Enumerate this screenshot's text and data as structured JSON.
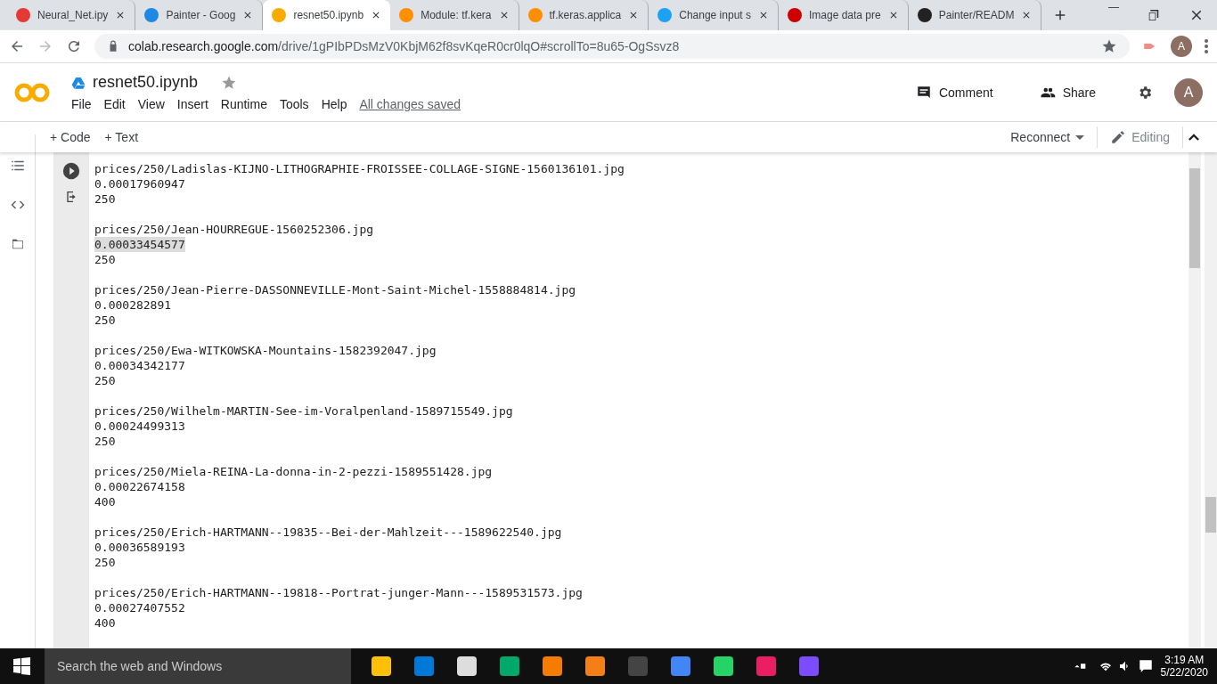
{
  "browser_tabs": [
    {
      "title": "Neural_Net.ipy",
      "selected": false
    },
    {
      "title": "Painter - Goog",
      "selected": false
    },
    {
      "title": "resnet50.ipynb",
      "selected": true
    },
    {
      "title": "Module: tf.kera",
      "selected": false
    },
    {
      "title": "tf.keras.applica",
      "selected": false
    },
    {
      "title": "Change input s",
      "selected": false
    },
    {
      "title": "Image data pre",
      "selected": false
    },
    {
      "title": "Painter/READM",
      "selected": false
    }
  ],
  "address_bar": {
    "host": "colab.research.google.com",
    "path": "/drive/1gPIbPDsMzV0KbjM62f8svKqeR0cr0lqO#scrollTo=8u65-OgSsvz8"
  },
  "profile_initial": "A",
  "notebook": {
    "title": "resnet50.ipynb",
    "menu": [
      "File",
      "Edit",
      "View",
      "Insert",
      "Runtime",
      "Tools",
      "Help"
    ],
    "save_status": "All changes saved"
  },
  "header_actions": {
    "comment": "Comment",
    "share": "Share",
    "avatar": "A"
  },
  "toolbar": {
    "add_code": "+ Code",
    "add_text": "+ Text",
    "connect": "Reconnect",
    "mode": "Editing"
  },
  "output": [
    {
      "path": "prices/250/Ladislas-KIJNO-LITHOGRAPHIE-FROISSEE-COLLAGE-SIGNE-1560136101.jpg",
      "score": "0.00017960947",
      "price": "250",
      "score_highlighted": false
    },
    {
      "path": "prices/250/Jean-HOURREGUE-1560252306.jpg",
      "score": "0.00033454577",
      "price": "250",
      "score_highlighted": true
    },
    {
      "path": "prices/250/Jean-Pierre-DASSONNEVILLE-Mont-Saint-Michel-1558884814.jpg",
      "score": "0.000282891",
      "price": "250",
      "score_highlighted": false
    },
    {
      "path": "prices/250/Ewa-WITKOWSKA-Mountains-1582392047.jpg",
      "score": "0.00034342177",
      "price": "250",
      "score_highlighted": false
    },
    {
      "path": "prices/250/Wilhelm-MARTIN-See-im-Voralpenland-1589715549.jpg",
      "score": "0.00024499313",
      "price": "250",
      "score_highlighted": false
    },
    {
      "path": "prices/250/Miela-REINA-La-donna-in-2-pezzi-1589551428.jpg",
      "score": "0.00022674158",
      "price": "400",
      "score_highlighted": false
    },
    {
      "path": "prices/250/Erich-HARTMANN--19835--Bei-der-Mahlzeit---1589622540.jpg",
      "score": "0.00036589193",
      "price": "250",
      "score_highlighted": false
    },
    {
      "path": "prices/250/Erich-HARTMANN--19818--Portrat-junger-Mann---1589531573.jpg",
      "score": "0.00027407552",
      "price": "400",
      "score_highlighted": false
    }
  ],
  "taskbar": {
    "search_placeholder": "Search the web and Windows",
    "time": "3:19 AM",
    "date": "5/22/2020"
  }
}
